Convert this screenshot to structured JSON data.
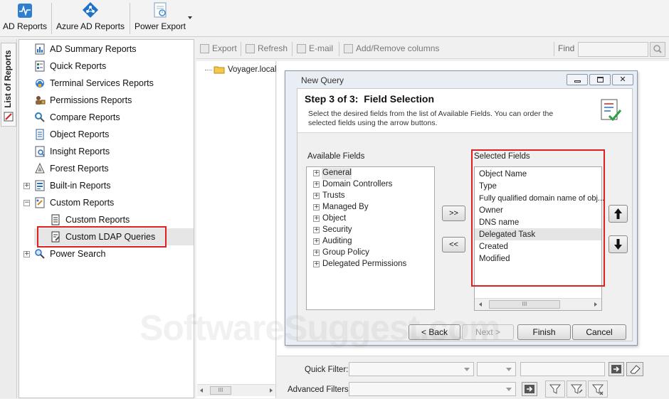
{
  "toolbar": {
    "ad_reports": "AD Reports",
    "azure_ad_reports": "Azure AD Reports",
    "power_export": "Power Export"
  },
  "side_tab": "List of Reports",
  "tree": [
    {
      "label": "AD Summary Reports",
      "icon": "summary-report-icon"
    },
    {
      "label": "Quick Reports",
      "icon": "quick-report-icon"
    },
    {
      "label": "Terminal Services Reports",
      "icon": "terminal-services-icon"
    },
    {
      "label": "Permissions Reports",
      "icon": "permissions-icon"
    },
    {
      "label": "Compare Reports",
      "icon": "compare-icon"
    },
    {
      "label": "Object Reports",
      "icon": "object-report-icon"
    },
    {
      "label": "Insight Reports",
      "icon": "insight-icon"
    },
    {
      "label": "Forest Reports",
      "icon": "forest-icon"
    },
    {
      "label": "Built-in Reports",
      "icon": "builtin-report-icon"
    },
    {
      "label": "Custom Reports",
      "icon": "custom-report-icon"
    },
    {
      "label": "Custom Reports",
      "icon": "custom-report-doc-icon"
    },
    {
      "label": "Custom LDAP Queries",
      "icon": "ldap-query-icon"
    },
    {
      "label": "Power Search",
      "icon": "power-search-icon"
    }
  ],
  "report_toolbar": {
    "export": "Export",
    "refresh": "Refresh",
    "email": "E-mail",
    "columns": "Add/Remove columns",
    "find": "Find"
  },
  "domain_tree": {
    "node": "Voyager.local"
  },
  "dialog": {
    "title": "New Query",
    "step": "Step 3 of 3:  Field Selection",
    "description": "Select the desired fields from the list of Available Fields. You can order the selected fields using the arrow buttons.",
    "available_label": "Available Fields",
    "selected_label": "Selected Fields",
    "available_fields": [
      "General",
      "Domain Controllers",
      "Trusts",
      "Managed By",
      "Object",
      "Security",
      "Auditing",
      "Group Policy",
      "Delegated Permissions"
    ],
    "selected_fields": [
      "Object Name",
      "Type",
      "Fully qualified domain name of obj...",
      "Owner",
      "DNS name",
      "Delegated Task",
      "Created",
      "Modified"
    ],
    "add_button": ">>",
    "remove_button": "<<",
    "back": "< Back",
    "next": "Next >",
    "finish": "Finish",
    "cancel": "Cancel"
  },
  "filters": {
    "quick": "Quick Filter:",
    "advanced": "Advanced Filters:"
  },
  "watermark": "SoftwareSuggest.com",
  "colors": {
    "highlight": "#e02020",
    "selection": "#e5e5e5",
    "accent": "#1e72c8"
  }
}
